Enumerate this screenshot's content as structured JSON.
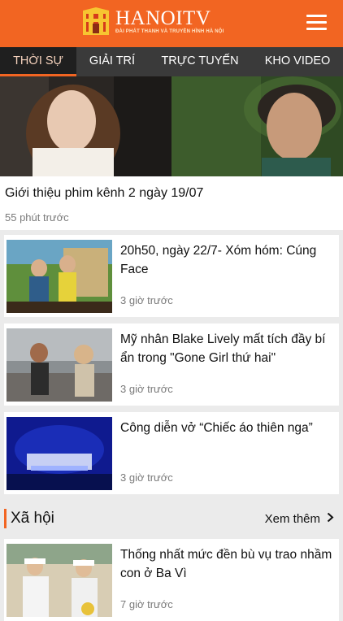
{
  "header": {
    "brand_title": "HANOITV",
    "brand_subtitle": "ĐÀI PHÁT THANH VÀ TRUYỀN HÌNH HÀ NỘI",
    "logo_icon": "hanoi-gate-icon",
    "menu_icon": "hamburger-icon"
  },
  "colors": {
    "accent": "#f26522",
    "tabbar": "#3a3a3a",
    "tab_active": "#1f1f1f"
  },
  "tabs": [
    {
      "label": "THỜI SỰ",
      "active": true
    },
    {
      "label": "GIẢI TRÍ",
      "active": false
    },
    {
      "label": "TRỰC TUYẾN",
      "active": false
    },
    {
      "label": "KHO VIDEO",
      "active": false
    }
  ],
  "hero": {
    "title": "Giới thiệu phim kênh 2 ngày 19/07",
    "time": "55 phút trước"
  },
  "articles": [
    {
      "title": "20h50, ngày 22/7- Xóm hóm: Cúng Face",
      "time": "3 giờ trước"
    },
    {
      "title": "Mỹ nhân Blake Lively mất tích đầy bí ẩn trong \"Gone Girl thứ hai\"",
      "time": "3 giờ trước"
    },
    {
      "title": "Công diễn vở “Chiếc áo thiên nga”",
      "time": "3 giờ trước"
    }
  ],
  "section": {
    "title": "Xã hội",
    "more_label": "Xem thêm",
    "more_icon": "chevron-right-icon"
  },
  "section_articles": [
    {
      "title": "Thống nhất mức đền bù vụ trao nhầm con ở Ba Vì",
      "time": "7 giờ trước"
    }
  ]
}
